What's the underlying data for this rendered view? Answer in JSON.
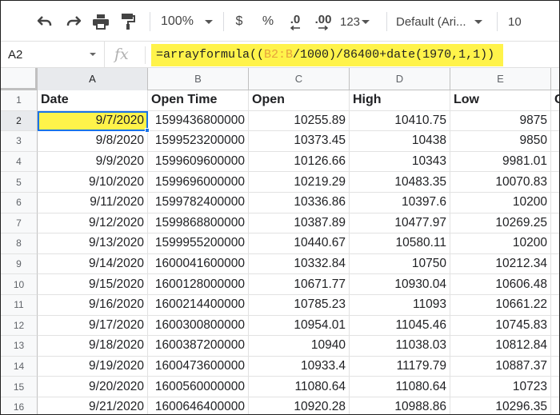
{
  "toolbar": {
    "zoom": "100%",
    "currency": "$",
    "percent": "%",
    "decrease_decimals": ".0",
    "increase_decimals": ".00",
    "more_formats": "123",
    "font": "Default (Ari...",
    "font_size": "10"
  },
  "formula_bar": {
    "cell_ref": "A2",
    "fx": "fx",
    "formula_pre": "=arrayformula((",
    "formula_ref": "B2:B",
    "formula_post": "/1000)/86400+date(1970,1,1))",
    "highlight_color": "#fff34a"
  },
  "columns": [
    "A",
    "B",
    "C",
    "D",
    "E"
  ],
  "header_row": {
    "row_number": "1",
    "cells": [
      "Date",
      "Open Time",
      "Open",
      "High",
      "Low",
      "C"
    ]
  },
  "rows": [
    {
      "n": "2",
      "date": "9/7/2020",
      "open_time": "1599436800000",
      "open": "10255.89",
      "high": "10410.75",
      "low": "9875"
    },
    {
      "n": "3",
      "date": "9/8/2020",
      "open_time": "1599523200000",
      "open": "10373.45",
      "high": "10438",
      "low": "9850"
    },
    {
      "n": "4",
      "date": "9/9/2020",
      "open_time": "1599609600000",
      "open": "10126.66",
      "high": "10343",
      "low": "9981.01"
    },
    {
      "n": "5",
      "date": "9/10/2020",
      "open_time": "1599696000000",
      "open": "10219.29",
      "high": "10483.35",
      "low": "10070.83"
    },
    {
      "n": "6",
      "date": "9/11/2020",
      "open_time": "1599782400000",
      "open": "10336.86",
      "high": "10397.6",
      "low": "10200"
    },
    {
      "n": "7",
      "date": "9/12/2020",
      "open_time": "1599868800000",
      "open": "10387.89",
      "high": "10477.97",
      "low": "10269.25"
    },
    {
      "n": "8",
      "date": "9/13/2020",
      "open_time": "1599955200000",
      "open": "10440.67",
      "high": "10580.11",
      "low": "10200"
    },
    {
      "n": "9",
      "date": "9/14/2020",
      "open_time": "1600041600000",
      "open": "10332.84",
      "high": "10750",
      "low": "10212.34"
    },
    {
      "n": "10",
      "date": "9/15/2020",
      "open_time": "1600128000000",
      "open": "10671.77",
      "high": "10930.04",
      "low": "10606.48"
    },
    {
      "n": "11",
      "date": "9/16/2020",
      "open_time": "1600214400000",
      "open": "10785.23",
      "high": "11093",
      "low": "10661.22"
    },
    {
      "n": "12",
      "date": "9/17/2020",
      "open_time": "1600300800000",
      "open": "10954.01",
      "high": "11045.46",
      "low": "10745.83"
    },
    {
      "n": "13",
      "date": "9/18/2020",
      "open_time": "1600387200000",
      "open": "10940",
      "high": "11038.03",
      "low": "10812.84"
    },
    {
      "n": "14",
      "date": "9/19/2020",
      "open_time": "1600473600000",
      "open": "10933.4",
      "high": "11179.79",
      "low": "10887.37"
    },
    {
      "n": "15",
      "date": "9/20/2020",
      "open_time": "1600560000000",
      "open": "11080.64",
      "high": "11080.64",
      "low": "10723"
    },
    {
      "n": "16",
      "date": "9/21/2020",
      "open_time": "1600646400000",
      "open": "10920.28",
      "high": "10988.86",
      "low": "10296.35"
    }
  ],
  "active_cell": "A2",
  "accent_color": "#1a73e8"
}
